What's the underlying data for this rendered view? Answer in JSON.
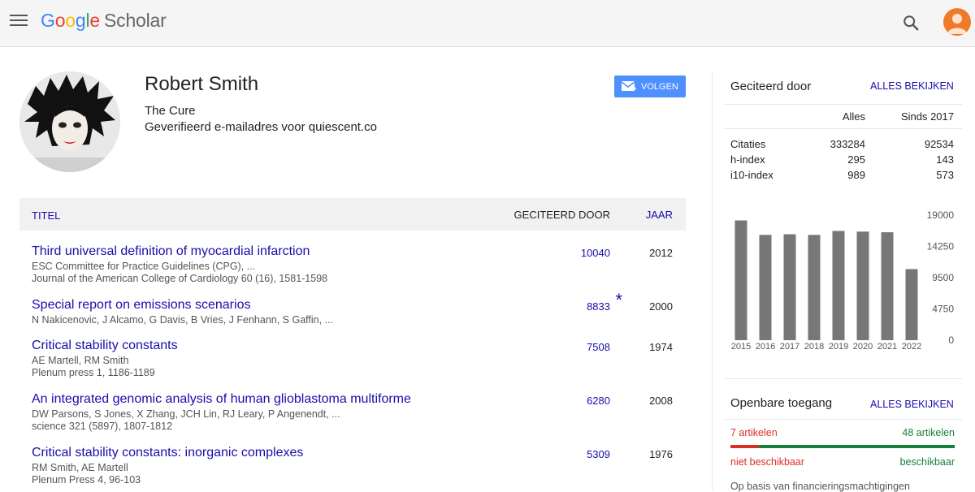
{
  "header": {
    "logo_letters": [
      "G",
      "o",
      "o",
      "g",
      "l",
      "e"
    ],
    "logo_suffix": "Scholar"
  },
  "profile": {
    "name": "Robert Smith",
    "affiliation": "The Cure",
    "email_note": "Geverifieerd e-mailadres voor quiescent.co",
    "follow_label": "VOLGEN"
  },
  "table": {
    "col_title": "TITEL",
    "col_cited": "GECITEERD DOOR",
    "col_year": "JAAR",
    "rows": [
      {
        "title": "Third universal definition of myocardial infarction",
        "authors": "ESC Committee for Practice Guidelines (CPG), ...",
        "venue": "Journal of the American College of Cardiology 60 (16), 1581-1598",
        "cites": "10040",
        "year": "2012",
        "star": ""
      },
      {
        "title": "Special report on emissions scenarios",
        "authors": "N Nakicenovic, J Alcamo, G Davis, B Vries, J Fenhann, S Gaffin, ...",
        "venue": "",
        "cites": "8833",
        "year": "2000",
        "star": "*"
      },
      {
        "title": "Critical stability constants",
        "authors": "AE Martell, RM Smith",
        "venue": "Plenum press 1, 1186-1189",
        "cites": "7508",
        "year": "1974",
        "star": ""
      },
      {
        "title": "An integrated genomic analysis of human glioblastoma multiforme",
        "authors": "DW Parsons, S Jones, X Zhang, JCH Lin, RJ Leary, P Angenendt, ...",
        "venue": "science 321 (5897), 1807-1812",
        "cites": "6280",
        "year": "2008",
        "star": ""
      },
      {
        "title": "Critical stability constants: inorganic complexes",
        "authors": "RM Smith, AE Martell",
        "venue": "Plenum Press 4, 96-103",
        "cites": "5309",
        "year": "1976",
        "star": ""
      }
    ]
  },
  "cited_by": {
    "heading": "Geciteerd door",
    "view_all": "ALLES BEKIJKEN",
    "col_all": "Alles",
    "col_since": "Sinds 2017",
    "stats": [
      {
        "label": "Citaties",
        "all": "333284",
        "since": "92534"
      },
      {
        "label": "h-index",
        "all": "295",
        "since": "143"
      },
      {
        "label": "i10-index",
        "all": "989",
        "since": "573"
      }
    ]
  },
  "chart_data": {
    "type": "bar",
    "categories": [
      "2015",
      "2016",
      "2017",
      "2018",
      "2019",
      "2020",
      "2021",
      "2022"
    ],
    "values": [
      18200,
      16000,
      16100,
      16000,
      16600,
      16500,
      16400,
      10800
    ],
    "yticks": [
      "19000",
      "14250",
      "9500",
      "4750",
      "0"
    ],
    "ylim": [
      0,
      19000
    ],
    "bar_color": "#777777"
  },
  "open_access": {
    "heading": "Openbare toegang",
    "view_all": "ALLES BEKIJKEN",
    "unavailable_count": "7 artikelen",
    "available_count": "48 artikelen",
    "unavailable_label": "niet beschikbaar",
    "available_label": "beschikbaar",
    "unavailable_fraction": 0.127,
    "note": "Op basis van financieringsmachtigingen"
  },
  "colors": {
    "link": "#1a0dab",
    "follow_button": "#4d90fe",
    "unavailable": "#d93025",
    "available": "#188038"
  }
}
